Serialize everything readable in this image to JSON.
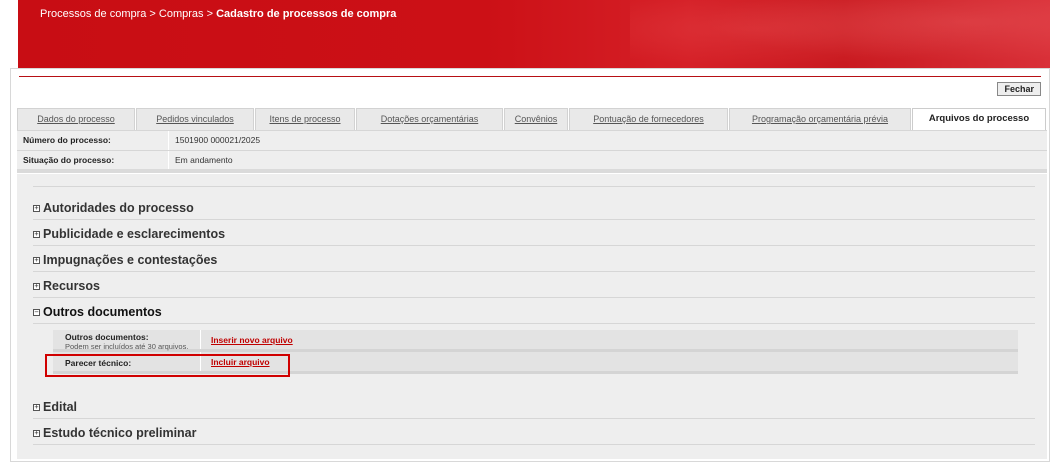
{
  "breadcrumb": {
    "path": "Processos de compra > Compras > ",
    "current": "Cadastro de processos de compra"
  },
  "toolbar": {
    "close_label": "Fechar"
  },
  "tabs": [
    {
      "label": "Dados do processo",
      "active": false
    },
    {
      "label": "Pedidos vinculados",
      "active": false
    },
    {
      "label": "Itens de processo",
      "active": false
    },
    {
      "label": "Dotações orçamentárias",
      "active": false
    },
    {
      "label": "Convênios",
      "active": false
    },
    {
      "label": "Pontuação de fornecedores",
      "active": false
    },
    {
      "label": "Programação orçamentária prévia",
      "active": false
    },
    {
      "label": "Arquivos do processo",
      "active": true
    }
  ],
  "info": {
    "process_number_label": "Número do processo:",
    "process_number_value": "1501900 000021/2025",
    "status_label": "Situação do processo:",
    "status_value": "Em andamento"
  },
  "sections": [
    {
      "title": "Autoridades do processo",
      "expanded": false
    },
    {
      "title": "Publicidade e esclarecimentos",
      "expanded": false
    },
    {
      "title": "Impugnações e contestações",
      "expanded": false
    },
    {
      "title": "Recursos",
      "expanded": false
    },
    {
      "title": "Outros documentos",
      "expanded": true
    },
    {
      "title": "Edital",
      "expanded": false
    },
    {
      "title": "Estudo técnico preliminar",
      "expanded": false
    }
  ],
  "other_docs": {
    "row1": {
      "title": "Outros documentos:",
      "subtitle": "Podem ser incluídos até 30 arquivos.",
      "link": "Inserir novo arquivo"
    },
    "row2": {
      "title": "Parecer técnico:",
      "link": "Incluir arquivo"
    }
  },
  "icons": {
    "expand": "+",
    "collapse": "−"
  },
  "colors": {
    "brand_red": "#c80d14",
    "link_red": "#c00000",
    "highlight": "#d00000"
  }
}
